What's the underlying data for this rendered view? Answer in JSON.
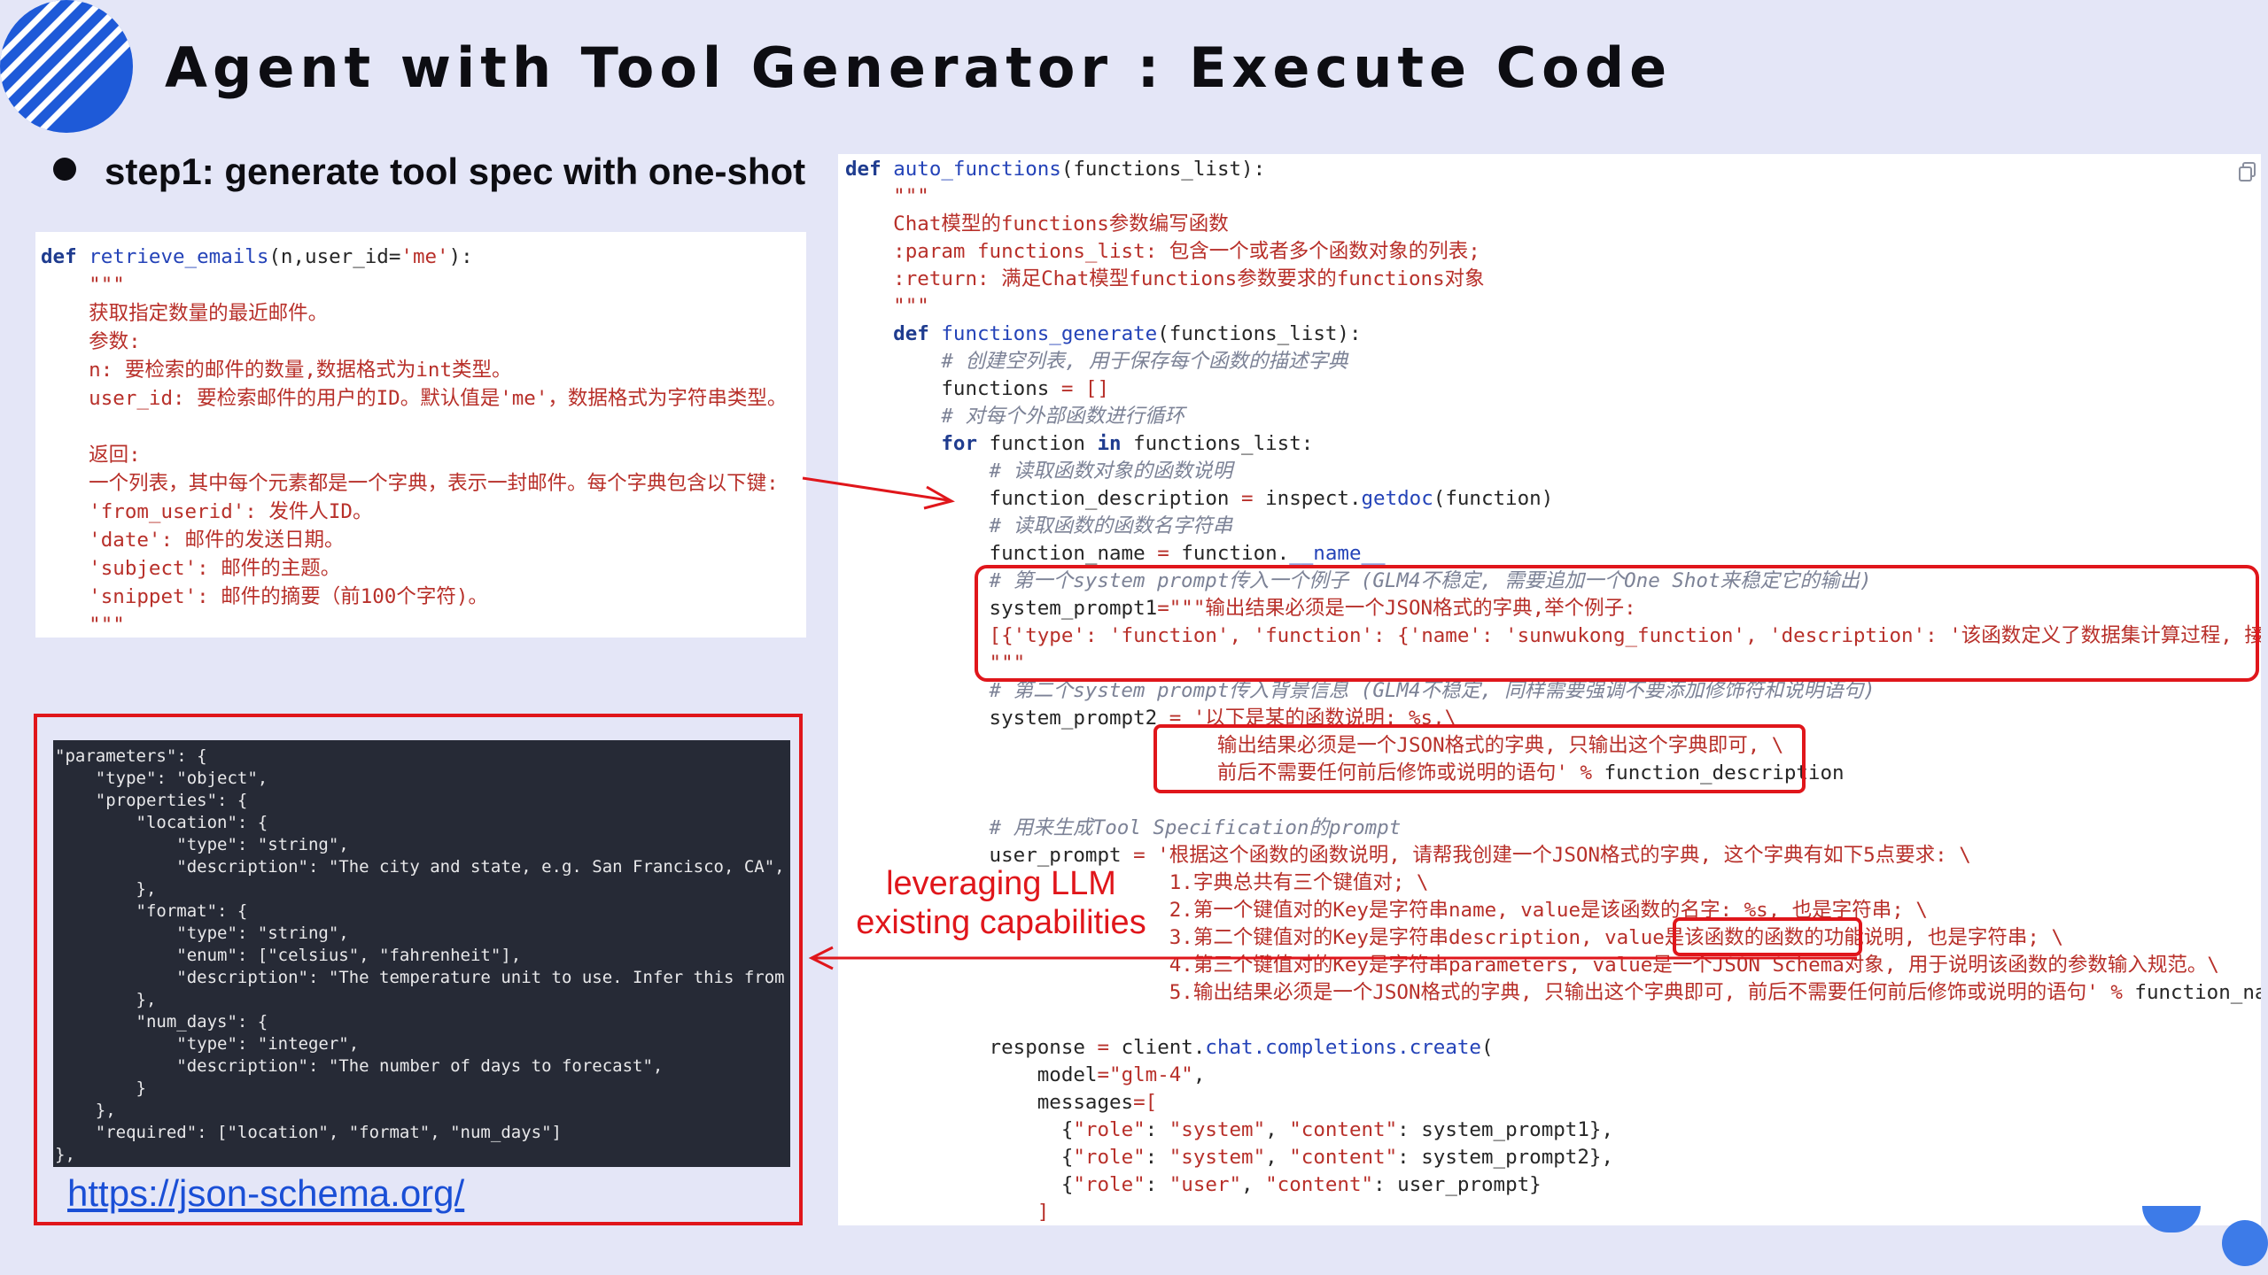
{
  "slide": {
    "title": "Agent with Tool Generator : Execute Code",
    "step": "step1: generate tool spec with one-shot",
    "annotation_line1": "leveraging LLM",
    "annotation_line2": "existing capabilities",
    "link": "https://json-schema.org/"
  },
  "left_code": {
    "def": "def",
    "fn_name": "retrieve_emails",
    "sig_args": "(n,user_id=",
    "sig_default": "'me'",
    "sig_end": "):",
    "doc_lines": [
      "    \"\"\"",
      "    获取指定数量的最近邮件。",
      "    参数:",
      "    n: 要检索的邮件的数量,数据格式为int类型。",
      "    user_id: 要检索邮件的用户的ID。默认值是'me'，数据格式为字符串类型。",
      "",
      "    返回:",
      "    一个列表，其中每个元素都是一个字典，表示一封邮件。每个字典包含以下键:",
      "    'from_userid': 发件人ID。",
      "    'date': 邮件的发送日期。",
      "    'subject': 邮件的主题。",
      "    'snippet': 邮件的摘要（前100个字符)。",
      "    \"\"\""
    ]
  },
  "json_schema_code": [
    "\"parameters\": {",
    "    \"type\": \"object\",",
    "    \"properties\": {",
    "        \"location\": {",
    "            \"type\": \"string\",",
    "            \"description\": \"The city and state, e.g. San Francisco, CA\",",
    "        },",
    "        \"format\": {",
    "            \"type\": \"string\",",
    "            \"enum\": [\"celsius\", \"fahrenheit\"],",
    "            \"description\": \"The temperature unit to use. Infer this from",
    "        },",
    "        \"num_days\": {",
    "            \"type\": \"integer\",",
    "            \"description\": \"The number of days to forecast\",",
    "        }",
    "    },",
    "    \"required\": [\"location\", \"format\", \"num_days\"]",
    "},"
  ],
  "right_code": {
    "l1_def": "def",
    "l1_fn": "auto_functions",
    "l1_rest": "(functions_list):",
    "l2": "    \"\"\"",
    "l3": "    Chat模型的functions参数编写函数",
    "l4": "    :param functions_list: 包含一个或者多个函数对象的列表;",
    "l5": "    :return: 满足Chat模型functions参数要求的functions对象",
    "l6": "    \"\"\"",
    "l7_def": "    def",
    "l7_fn": "functions_generate",
    "l7_rest": "(functions_list):",
    "l8": "        # 创建空列表, 用于保存每个函数的描述字典",
    "l9_a": "        functions ",
    "l9_op": "=",
    "l9_b": " []",
    "l10": "        # 对每个外部函数进行循环",
    "l11_for": "        for",
    "l11_mid": " function ",
    "l11_in": "in",
    "l11_end": " functions_list:",
    "l12": "            # 读取函数对象的函数说明",
    "l13_a": "            function_description ",
    "l13_op": "=",
    "l13_b": " inspect.",
    "l13_fn": "getdoc",
    "l13_c": "(function)",
    "l14": "            # 读取函数的函数名字符串",
    "l15_a": "            function_name ",
    "l15_op": "=",
    "l15_b": " function.",
    "l15_fn": "__name__",
    "l16": "            # 第一个system prompt传入一个例子 (GLM4不稳定, 需要追加一个One Shot来稳定它的输出)",
    "l17_a": "            system_prompt1",
    "l17_op": "=",
    "l17_st": "\"\"\"输出结果必须是一个JSON格式的字典,举个例子:",
    "l18": "            [{'type': 'function', 'function': {'name': 'sunwukong_function', 'description': '该函数定义了数据集计算过程, 接收一个",
    "l19": "            \"\"\"",
    "l20": "            # 第二个system prompt传入背景信息 (GLM4不稳定, 同样需要强调不要添加修饰符和说明语句)",
    "l21_a": "            system_prompt2 ",
    "l21_op": "=",
    "l21_st": " '以下是某的函数说明: %s,\\",
    "l22": "                               输出结果必须是一个JSON格式的字典, 只输出这个字典即可, \\",
    "l23_st": "                               前后不需要任何前后修饰或说明的语句' ",
    "l23_op": "%",
    "l23_b": " function_description",
    "l24": "",
    "l25": "            # 用来生成Tool Specification的prompt",
    "l26_a": "            user_prompt ",
    "l26_op": "=",
    "l26_st": " '根据这个函数的函数说明, 请帮我创建一个JSON格式的字典, 这个字典有如下5点要求: \\",
    "l27": "                           1.字典总共有三个键值对; \\",
    "l28": "                           2.第一个键值对的Key是字符串name, value是该函数的名字: %s, 也是字符串; \\",
    "l29": "                           3.第二个键值对的Key是字符串description, value是该函数的函数的功能说明, 也是字符串; \\",
    "l30": "                           4.第三个键值对的Key是字符串parameters, value是一个JSON Schema对象, 用于说明该函数的参数输入规范。\\",
    "l31_st": "                           5.输出结果必须是一个JSON格式的字典, 只输出这个字典即可, 前后不需要任何前后修饰或说明的语句' ",
    "l31_op": "%",
    "l31_b": " function_name",
    "l32": "",
    "l33_a": "            response ",
    "l33_op": "=",
    "l33_b": " client.",
    "l33_fn": "chat.completions.create",
    "l33_c": "(",
    "l34_a": "                model",
    "l34_op": "=",
    "l34_st": "\"glm-4\"",
    "l34_c": ",",
    "l35_a": "                messages",
    "l35_op": "=[",
    "l36_a": "                  {",
    "l36_st1": "\"role\"",
    "l36_b": ": ",
    "l36_st2": "\"system\"",
    "l36_c": ", ",
    "l36_st3": "\"content\"",
    "l36_d": ": system_prompt1},",
    "l37_d": ": system_prompt2},",
    "l38_st2": "\"user\"",
    "l38_d": ": user_prompt}",
    "l39": "                ]",
    "l40": "            )"
  },
  "colors": {
    "accent_red": "#e0161b",
    "background": "#e4e6f7",
    "link_blue": "#1a4fd6",
    "code_keyword": "#1f3c8f",
    "code_string": "#b8302a",
    "code_comment": "#7c8296"
  },
  "icons": [
    "striped-circle-logo-icon",
    "bullet-icon",
    "copy-icon",
    "arrow-right-icon",
    "arrow-left-icon"
  ]
}
